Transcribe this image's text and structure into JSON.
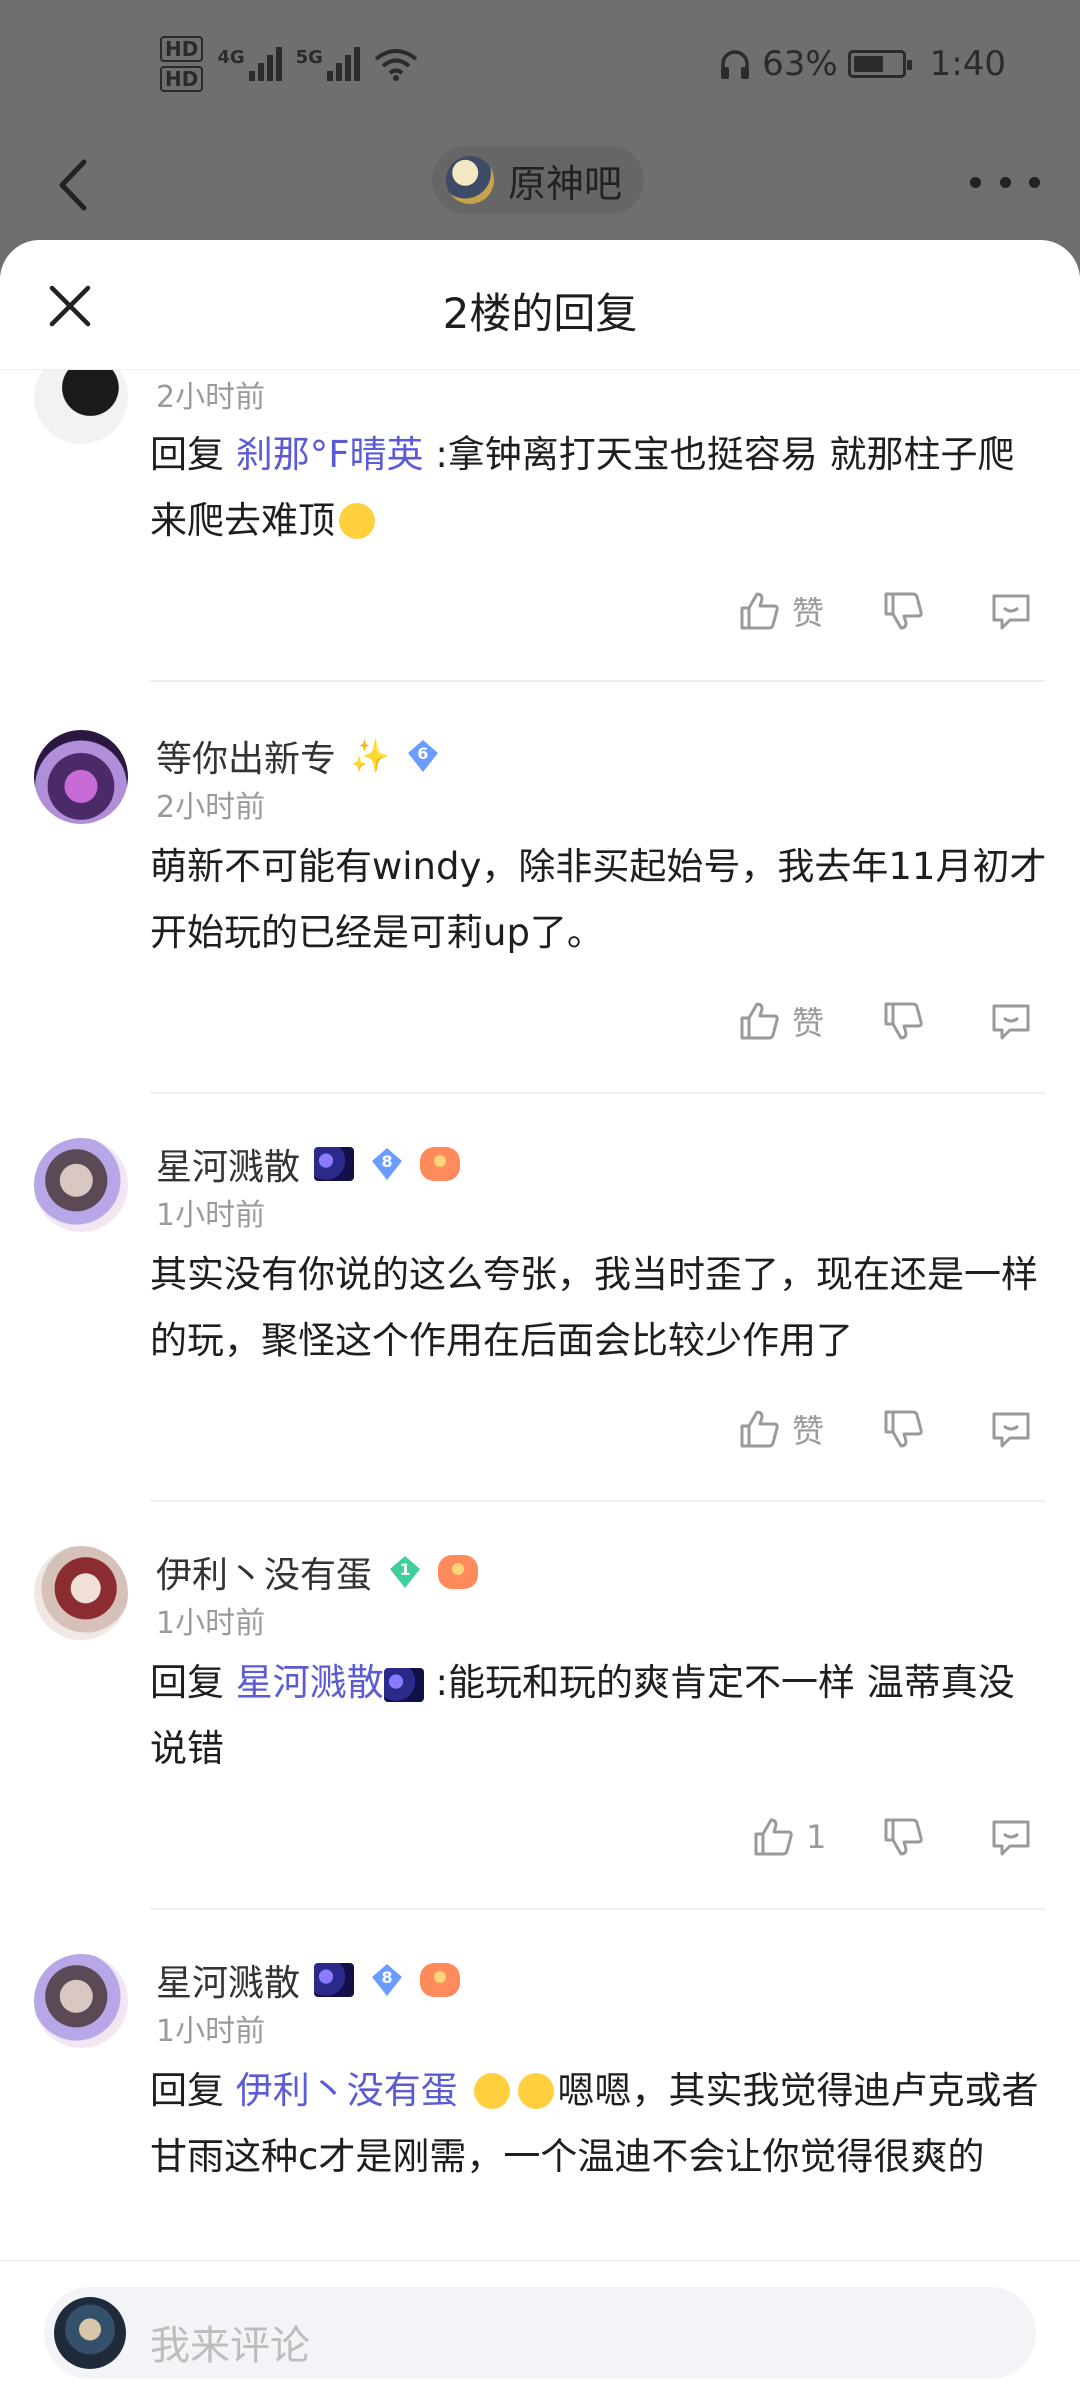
{
  "status_bar": {
    "network_1": "4G",
    "network_2": "5G",
    "battery_text": "63%",
    "battery_level": 0.63,
    "time": "1:40",
    "hd1": "HD",
    "hd2": "HD"
  },
  "app_header": {
    "forum_name": "原神吧"
  },
  "sheet": {
    "title": "2楼的回复"
  },
  "replies": [
    {
      "username": "",
      "time": "2小时前",
      "prefix": "回复",
      "mention": "刹那°F晴英",
      "text": ":拿钟离打天宝也挺容易 就那柱子爬来爬去难顶",
      "like_label": "赞"
    },
    {
      "username": "等你出新专",
      "level": "6",
      "time": "2小时前",
      "text": "萌新不可能有windy，除非买起始号，我去年11月初才开始玩的已经是可莉up了。",
      "like_label": "赞"
    },
    {
      "username": "星河溅散",
      "level": "8",
      "time": "1小时前",
      "text": "其实没有你说的这么夸张，我当时歪了，现在还是一样的玩，聚怪这个作用在后面会比较少作用了",
      "like_label": "赞"
    },
    {
      "username": "伊利丶没有蛋",
      "level": "1",
      "time": "1小时前",
      "prefix": "回复",
      "mention": "星河溅散",
      "text": ":能玩和玩的爽肯定不一样 温蒂真没说错",
      "like_label": "1"
    },
    {
      "username": "星河溅散",
      "level": "8",
      "time": "1小时前",
      "prefix": "回复",
      "mention": "伊利丶没有蛋",
      "text": "嗯嗯，其实我觉得迪卢克或者甘雨这种c才是刚需，一个温迪不会让你觉得很爽的"
    }
  ],
  "composer": {
    "placeholder": "我来评论"
  },
  "colors": {
    "mention": "#5b5bd6",
    "badge_blue": "#6b9cff",
    "badge_green": "#3fcf9a",
    "sheet_bg": "#ffffff",
    "dim_bg": "#6f6f6f"
  },
  "icons": [
    "back-icon",
    "more-icon",
    "close-icon",
    "thumb-up-icon",
    "thumb-down-icon",
    "comment-icon",
    "wifi-icon",
    "battery-icon",
    "headphones-icon"
  ]
}
